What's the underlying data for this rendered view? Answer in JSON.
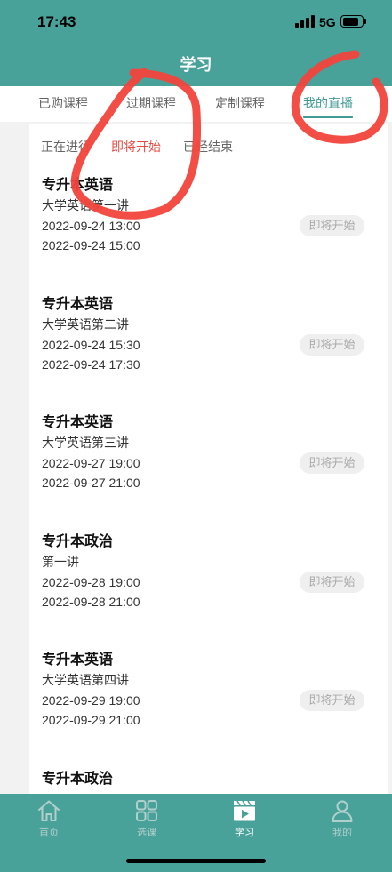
{
  "status_bar": {
    "time": "17:43",
    "network": "5G",
    "signal_bars": 4,
    "battery_level": 0.85,
    "icons": {
      "signal": "signal-icon",
      "battery": "battery-icon"
    }
  },
  "header": {
    "title": "学习"
  },
  "top_tabs": [
    {
      "label": "已购课程",
      "active": false
    },
    {
      "label": "过期课程",
      "active": false
    },
    {
      "label": "定制课程",
      "active": false
    },
    {
      "label": "我的直播",
      "active": true
    }
  ],
  "sub_tabs": [
    {
      "label": "正在进行",
      "active": false
    },
    {
      "label": "即将开始",
      "active": true
    },
    {
      "label": "已经结束",
      "active": false
    }
  ],
  "live_list": [
    {
      "course": "专升本英语",
      "lesson": "大学英语第一讲",
      "start": "2022-09-24 13:00",
      "end": "2022-09-24 15:00",
      "status": "即将开始"
    },
    {
      "course": "专升本英语",
      "lesson": "大学英语第二讲",
      "start": "2022-09-24 15:30",
      "end": "2022-09-24 17:30",
      "status": "即将开始"
    },
    {
      "course": "专升本英语",
      "lesson": "大学英语第三讲",
      "start": "2022-09-27 19:00",
      "end": "2022-09-27 21:00",
      "status": "即将开始"
    },
    {
      "course": "专升本政治",
      "lesson": "第一讲",
      "start": "2022-09-28 19:00",
      "end": "2022-09-28 21:00",
      "status": "即将开始"
    },
    {
      "course": "专升本英语",
      "lesson": "大学英语第四讲",
      "start": "2022-09-29 19:00",
      "end": "2022-09-29 21:00",
      "status": "即将开始"
    },
    {
      "course": "专升本政治"
    }
  ],
  "bottom_nav": [
    {
      "label": "首页",
      "icon": "home-icon",
      "active": false
    },
    {
      "label": "选课",
      "icon": "grid-icon",
      "active": false
    },
    {
      "label": "学习",
      "icon": "play-video-icon",
      "active": true
    },
    {
      "label": "我的",
      "icon": "person-icon",
      "active": false
    }
  ],
  "colors": {
    "brand": "#48a29a",
    "tab_active": "#3f9b93",
    "sub_tab_active": "#e34b43",
    "badge_bg": "#efefef",
    "badge_text": "#aaaaaa",
    "nav_inactive": "#b3cfcc",
    "annotation": "#f2443c"
  }
}
